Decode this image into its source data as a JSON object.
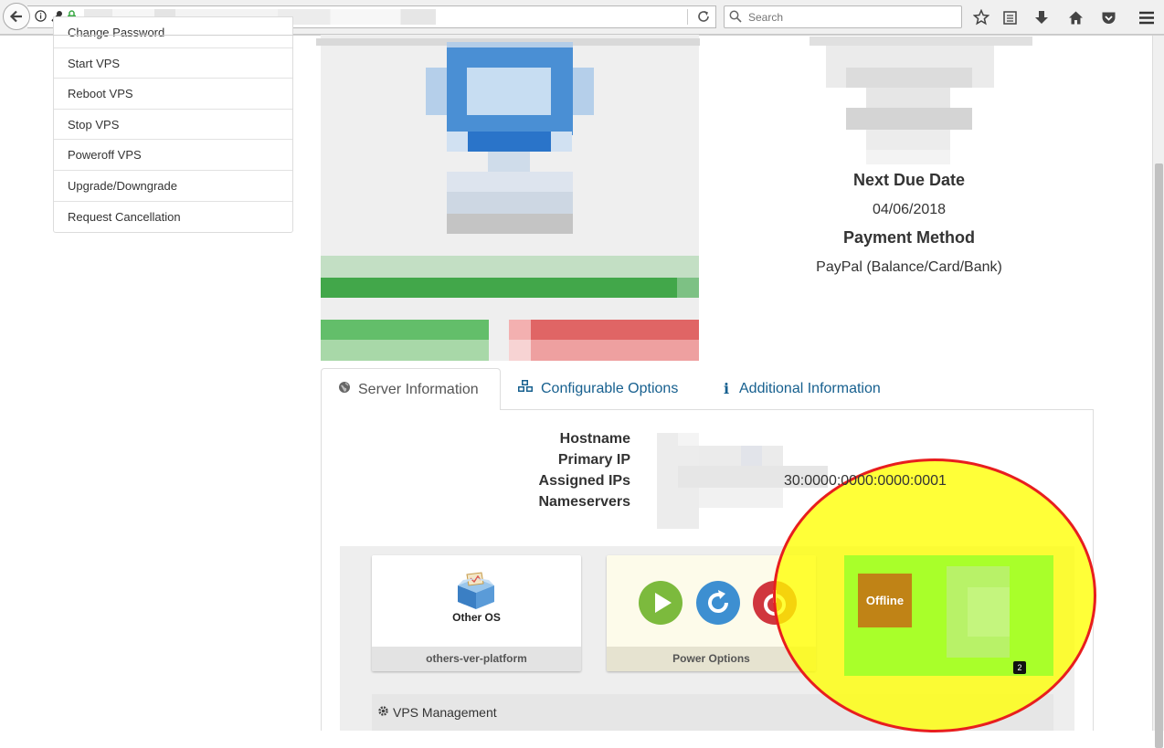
{
  "browser": {
    "search_placeholder": "Search"
  },
  "sidebar": {
    "items": [
      {
        "label": "Change Password"
      },
      {
        "label": "Start VPS"
      },
      {
        "label": "Reboot VPS"
      },
      {
        "label": "Stop VPS"
      },
      {
        "label": "Poweroff VPS"
      },
      {
        "label": "Upgrade/Downgrade"
      },
      {
        "label": "Request Cancellation"
      }
    ]
  },
  "billing": {
    "next_due_label": "Next Due Date",
    "next_due_value": "04/06/2018",
    "payment_label": "Payment Method",
    "payment_value": "PayPal (Balance/Card/Bank)"
  },
  "tabs": [
    {
      "label": "Server Information",
      "icon": "globe-icon"
    },
    {
      "label": "Configurable Options",
      "icon": "cubes-icon"
    },
    {
      "label": "Additional Information",
      "icon": "info-icon"
    }
  ],
  "server_info": {
    "hostname_label": "Hostname",
    "primary_ip_label": "Primary IP",
    "assigned_ips_label": "Assigned IPs",
    "nameservers_label": "Nameservers",
    "assigned_ip_visible": "30:0000:0000:0000:0001"
  },
  "vps": {
    "os_label": "Other OS",
    "os_footer": "others-ver-platform",
    "power_footer": "Power Options",
    "status_badge": "Offline",
    "count_badge": "2",
    "management_label": "VPS Management"
  },
  "colors": {
    "link": "#17608f",
    "highlight_fill": "#ffff00",
    "highlight_border": "#e81e1e",
    "status_card": "#a9ff2a",
    "offline_badge": "#c08316"
  }
}
